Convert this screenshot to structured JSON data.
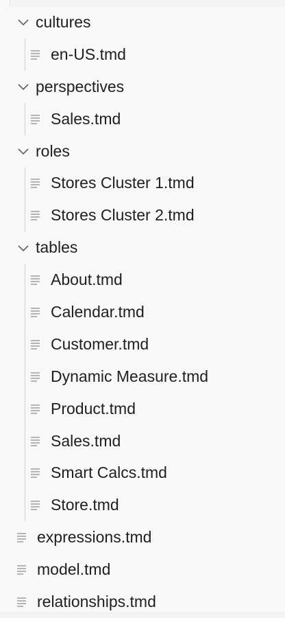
{
  "explorer": {
    "folders": [
      {
        "name": "cultures",
        "files": [
          "en-US.tmd"
        ]
      },
      {
        "name": "perspectives",
        "files": [
          "Sales.tmd"
        ]
      },
      {
        "name": "roles",
        "files": [
          "Stores Cluster 1.tmd",
          "Stores Cluster 2.tmd"
        ]
      },
      {
        "name": "tables",
        "files": [
          "About.tmd",
          "Calendar.tmd",
          "Customer.tmd",
          "Dynamic Measure.tmd",
          "Product.tmd",
          "Sales.tmd",
          "Smart Calcs.tmd",
          "Store.tmd"
        ]
      }
    ],
    "root_files": [
      "expressions.tmd",
      "model.tmd",
      "relationships.tmd"
    ],
    "icons": {
      "folder": "chevron-down-icon",
      "file": "file-lines-icon"
    },
    "colors": {
      "background": "#f8f8f8",
      "text": "#1f1f1f",
      "guide": "#d0d0d0",
      "icon": "#8a8a8a"
    }
  }
}
